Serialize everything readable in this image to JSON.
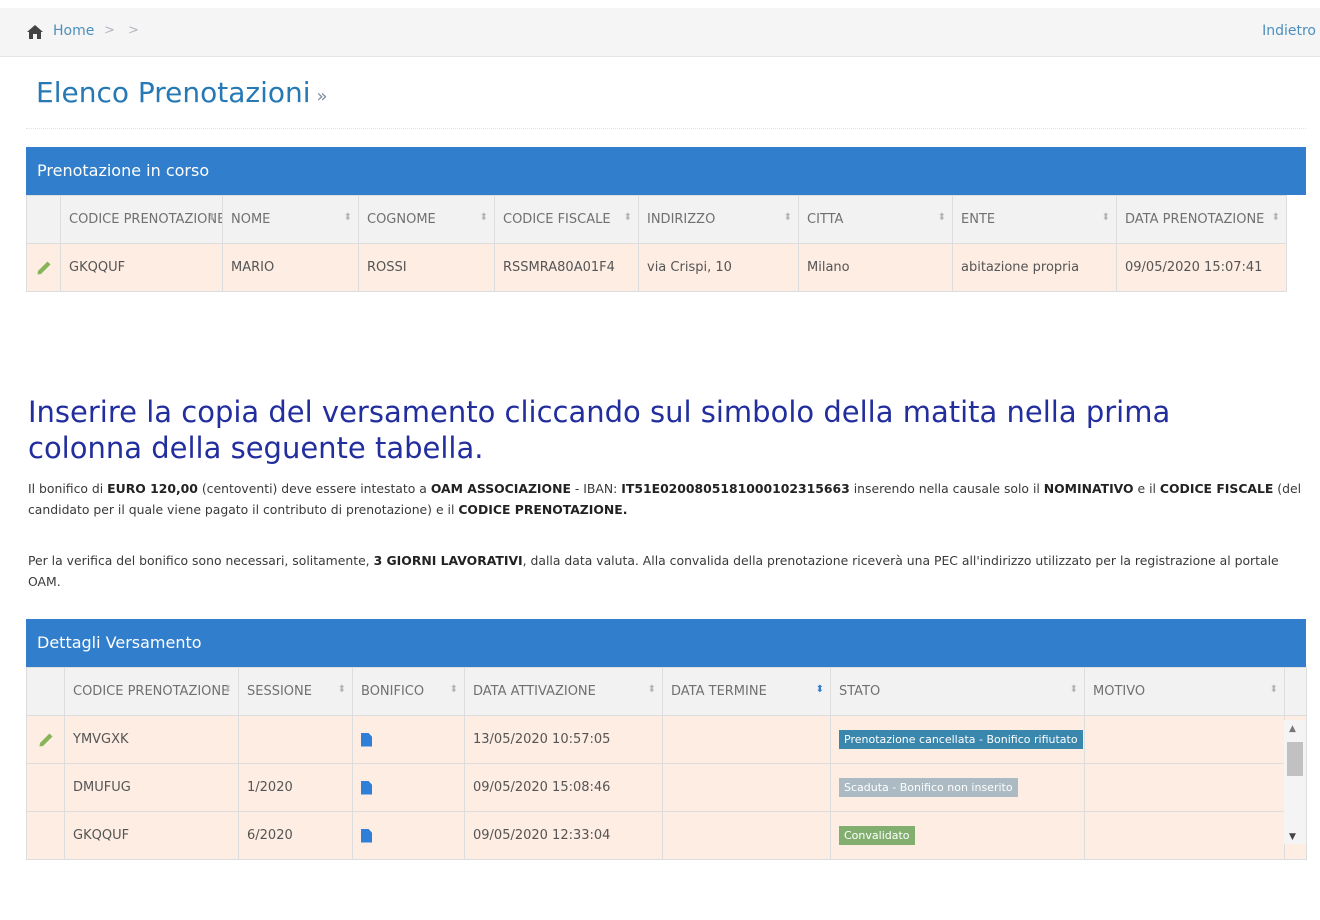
{
  "breadcrumb": {
    "home_label": "Home",
    "separator": ">",
    "back_label": "Indietro"
  },
  "page": {
    "title": "Elenco Prenotazioni",
    "title_suffix": "»"
  },
  "current_booking": {
    "panel_title": "Prenotazione in corso",
    "columns": [
      "CODICE PRENOTAZIONE",
      "NOME",
      "COGNOME",
      "CODICE FISCALE",
      "INDIRIZZO",
      "CITTA",
      "ENTE",
      "DATA PRENOTAZIONE"
    ],
    "row": {
      "codice": "GKQQUF",
      "nome": "MARIO",
      "cognome": "ROSSI",
      "codice_fiscale": "RSSMRA80A01F4",
      "indirizzo": "via Crispi, 10",
      "citta": "Milano",
      "ente": "abitazione propria",
      "data": "09/05/2020 15:07:41"
    }
  },
  "instructions": {
    "heading": "Inserire la copia del versamento cliccando sul simbolo della matita nella prima colonna della seguente tabella.",
    "p1": {
      "t1": "Il bonifico di ",
      "b1": "EURO 120,00",
      "t2": " (centoventi) deve essere intestato a ",
      "b2": "OAM ASSOCIAZIONE",
      "t3": " - IBAN: ",
      "b3": "IT51E0200805181000102315663",
      "t4": " inserendo nella causale solo il ",
      "b4": "NOMINATIVO",
      "t5": " e il ",
      "b5": "CODICE FISCALE",
      "t6": " (del candidato per il quale viene pagato il contributo di prenotazione) e il ",
      "b6": "CODICE PRENOTAZIONE."
    },
    "p2": {
      "t1": "Per la verifica del bonifico sono necessari, solitamente, ",
      "b1": "3 GIORNI LAVORATIVI",
      "t2": ", dalla data valuta. Alla convalida della prenotazione riceverà una PEC all'indirizzo utilizzato per la registrazione al portale OAM."
    }
  },
  "payments": {
    "panel_title": "Dettagli Versamento",
    "columns": [
      "CODICE PRENOTAZIONE",
      "SESSIONE",
      "BONIFICO",
      "DATA ATTIVAZIONE",
      "DATA TERMINE",
      "STATO",
      "MOTIVO"
    ],
    "rows": [
      {
        "codice": "YMVGXK",
        "sessione": "",
        "data_attivazione": "13/05/2020 10:57:05",
        "data_termine": "",
        "stato": "Prenotazione cancellata - Bonifico rifiutato",
        "stato_color": "#3a87ad",
        "motivo": "",
        "editable": true
      },
      {
        "codice": "DMUFUG",
        "sessione": "1/2020",
        "data_attivazione": "09/05/2020 15:08:46",
        "data_termine": "",
        "stato": "Scaduta - Bonifico non inserito",
        "stato_color": "#abbac3",
        "motivo": "",
        "editable": false
      },
      {
        "codice": "GKQQUF",
        "sessione": "6/2020",
        "data_attivazione": "09/05/2020 12:33:04",
        "data_termine": "",
        "stato": "Convalidato",
        "stato_color": "#82af6f",
        "motivo": "",
        "editable": false
      }
    ]
  },
  "icons": {
    "home": "home-icon",
    "pencil": "pencil-icon",
    "document": "document-icon",
    "sort": "sort-icon"
  },
  "colors": {
    "primary": "#307ecc",
    "link": "#4c8fbd",
    "heading": "#222d9e",
    "row_highlight": "#fdede3",
    "pencil": "#86b558"
  }
}
